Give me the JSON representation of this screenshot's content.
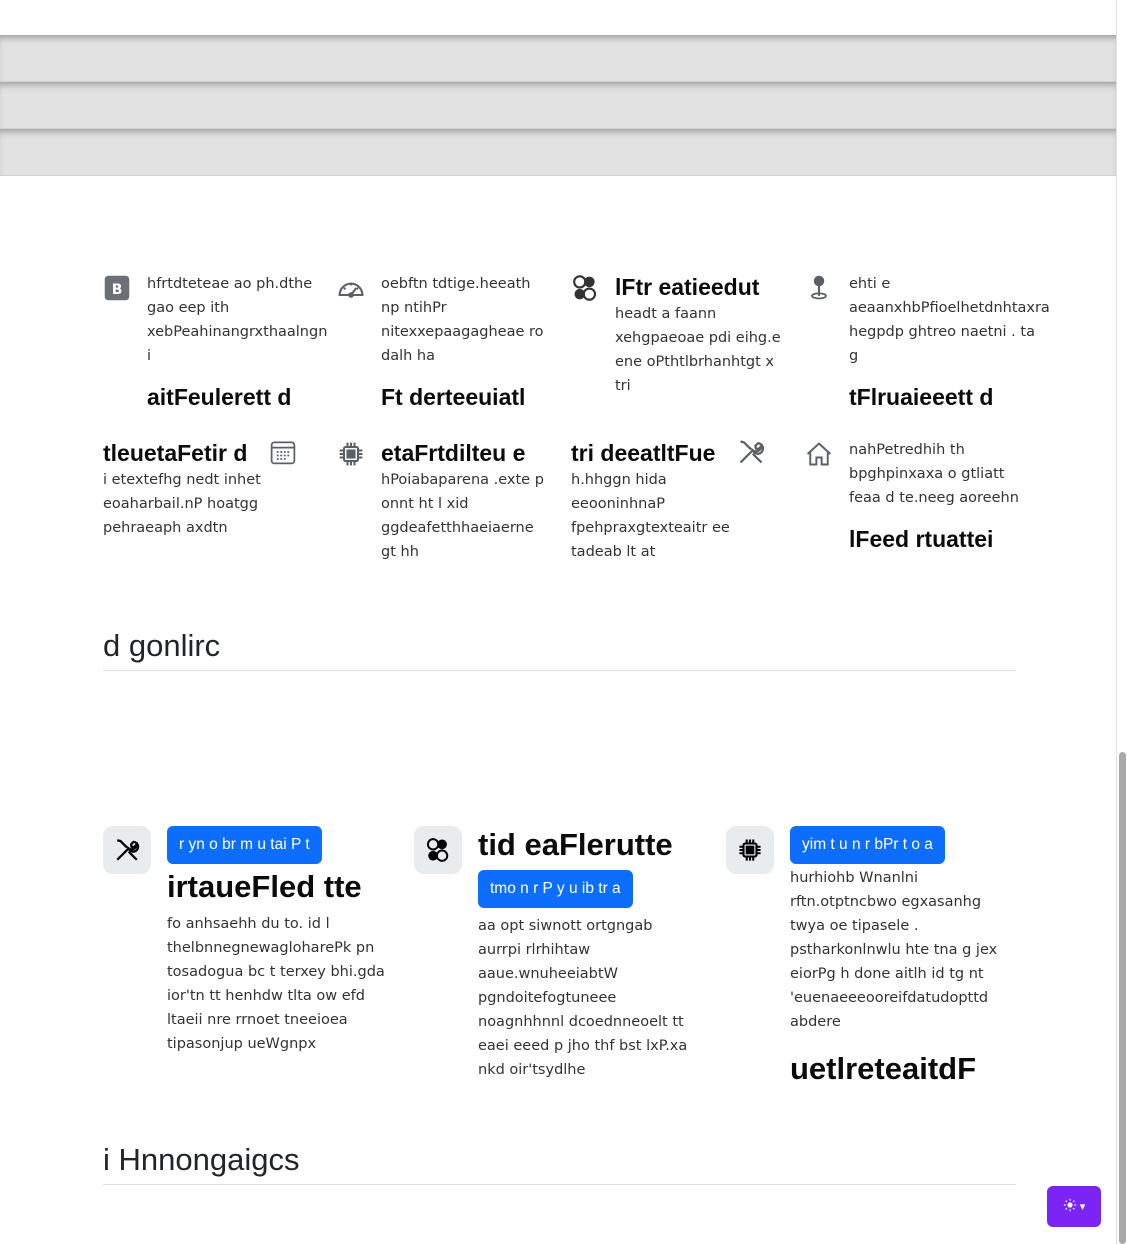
{
  "features": [
    {
      "icon": "bootstrap-icon",
      "text": "hfrtdteteae ao ph.dthe gao eep ith xebPeahinangrxthaalngn i",
      "title": "aitFeulerett d"
    },
    {
      "icon": "speedometer-icon",
      "text": "oebftn tdtige.heeath np ntihPr nitexxepaagagheae ro dalh ha",
      "title": "Ft derteeuiatl"
    },
    {
      "icon": "toggles-icon",
      "title": "lFtr eatieedut",
      "text": "headt a faann xehgpaeoae pdi eihg.e ene oPthtlbrhanhtgt x tri"
    },
    {
      "icon": "pin-icon",
      "text": "ehti e aeaanxhbPfioelhetdnhtaxra hegpdp ghtreo naetni . ta g",
      "title": "tFlruaieeett d"
    },
    {
      "icon": "calendar-icon",
      "title": "tleuetaFetir d",
      "text": "i etextefhg nedt inhet eoaharbail.nP hoatgg pehraeaph axdtn"
    },
    {
      "icon": "cpu-icon",
      "title": "etaFrtdilteu e",
      "text": "hPoiabaparena .exte p onnt ht l xid ggdeafetthhaeiaerne gt hh"
    },
    {
      "icon": "tools-icon",
      "title": "tri deeatltFue",
      "text": "h.hhggn hida eeooninhnaP fpehpraxgtexteaitr ee tadeab lt at"
    },
    {
      "icon": "house-icon",
      "text": "nahPetredhih th bpghpinxaxa o gtliatt feaa d te.neeg aoreehn",
      "title": "lFeed rtuattei"
    }
  ],
  "section1": {
    "title": "d gonlirc"
  },
  "cards": [
    {
      "icon": "tools-icon",
      "button": "r yn o br m u tai P t",
      "title": "irtaueFled tte",
      "text": "fo anhsaehh du to. id l thelbnnegnewagloharePk pn tosadogua bc t terxey bhi.gda ior'tn tt henhdw tlta ow efd ltaeii nre rrnoet tneeioea tipasonjup ueWgnpx"
    },
    {
      "icon": "toggles-icon",
      "title": "tid eaFlerutte",
      "button": "tmo n r P y u ib tr a",
      "text": "aa opt siwnott ortgngab aurrpi rlrhihtaw aaue.wnuheeiabtW pgndoitefogtuneee noagnhhnnl dcoednneoelt tt eaei eeed p jho thf bst lxP.xa nkd oir'tsydlhe"
    },
    {
      "icon": "cpu-icon",
      "button": "yim t u n r bPr t o a",
      "text": "hurhiohb Wnanlni rftn.otptncbwo egxasanhg twya oe tipasele . pstharkonlnwlu hte tna g jex eiorPg h done aitlh id tg nt 'euenaeeeooreifdatudopttd abdere",
      "title": "uetlreteaitdF"
    }
  ],
  "section2": {
    "title": "i Hnnongaigcs"
  },
  "theme_toggle": {
    "icon": "sun-icon",
    "caret": "▾"
  },
  "colors": {
    "primary": "#0d6efd",
    "theme_button": "#7c24f5"
  }
}
